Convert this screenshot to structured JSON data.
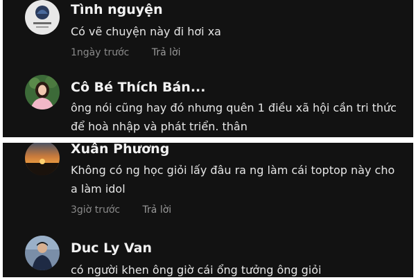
{
  "comments": [
    {
      "author": "Tình nguyện",
      "text": "Có vẽ chuyện này đi hơi xa",
      "time": "1ngày trước",
      "reply": "Trả lời"
    },
    {
      "author": "Cô Bé Thích Bán...",
      "text": "ông nói cũng hay đó nhưng quên 1 điều xã hội cần tri thức để hoà nhập và phát triển. thân",
      "time": "",
      "reply": ""
    },
    {
      "author": "Xuân Phương",
      "text": "Không có ng học giỏi lấy đâu ra ng làm cái toptop này cho a làm idol",
      "time": "3giờ trước",
      "reply": "Trả lời"
    },
    {
      "author": "Duc Ly Van",
      "text": "có người khen ông giờ cái ổng tưởng ông giỏi",
      "time": "",
      "reply": ""
    }
  ],
  "colors": {
    "background": "#121212",
    "author": "#f2f2f2",
    "text": "#e6e6e6",
    "meta": "#8a8a8a"
  }
}
